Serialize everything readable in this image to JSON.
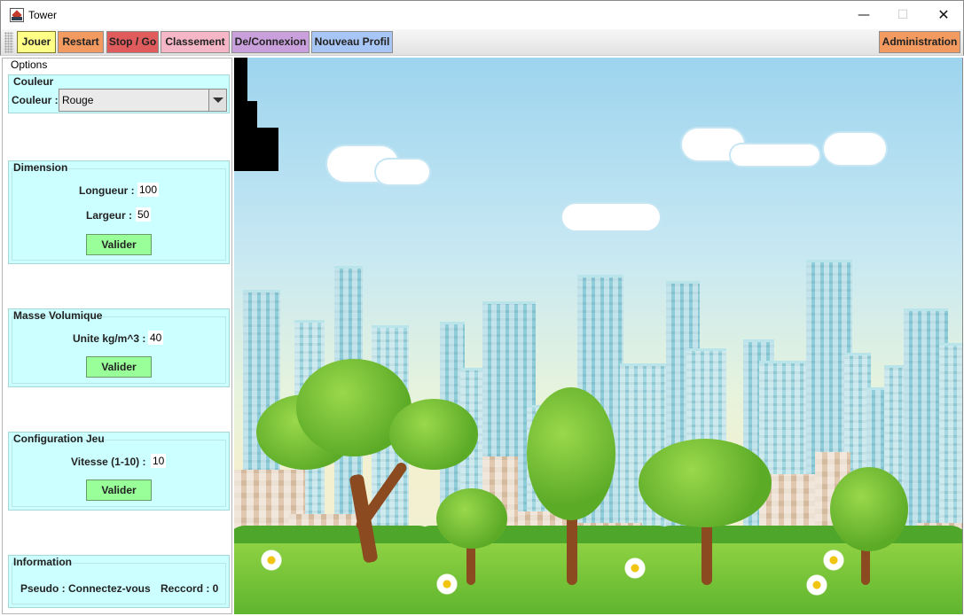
{
  "window": {
    "title": "Tower",
    "min": "—",
    "max": "☐",
    "close": "✕"
  },
  "toolbar": {
    "jouer": "Jouer",
    "restart": "Restart",
    "stop_go": "Stop / Go",
    "classement": "Classement",
    "connexion": "De/Connexion",
    "nouveau_profil": "Nouveau Profil",
    "administration": "Administration"
  },
  "options": {
    "title": "Options",
    "couleur": {
      "legend": "Couleur",
      "label": "Couleur :",
      "value": "Rouge"
    },
    "dimension": {
      "legend": "Dimension",
      "longueur_label": "Longueur :",
      "longueur": "100",
      "largeur_label": "Largeur :",
      "largeur": "50",
      "valider": "Valider"
    },
    "masse": {
      "legend": "Masse Volumique",
      "unite_label": "Unite kg/m^3 :",
      "unite": "40",
      "valider": "Valider"
    },
    "config": {
      "legend": "Configuration Jeu",
      "vitesse_label": "Vitesse (1-10) :",
      "vitesse": "10",
      "valider": "Valider"
    },
    "information": {
      "legend": "Information",
      "pseudo": "Pseudo : Connectez-vous",
      "record": "Reccord : 0"
    }
  },
  "colors": {
    "panel_bg": "#ccffff",
    "valider_bg": "#99ff99",
    "tower": "#000000"
  },
  "icons": {
    "app": "tower-app-icon",
    "dropdown": "chevron-down-icon"
  }
}
